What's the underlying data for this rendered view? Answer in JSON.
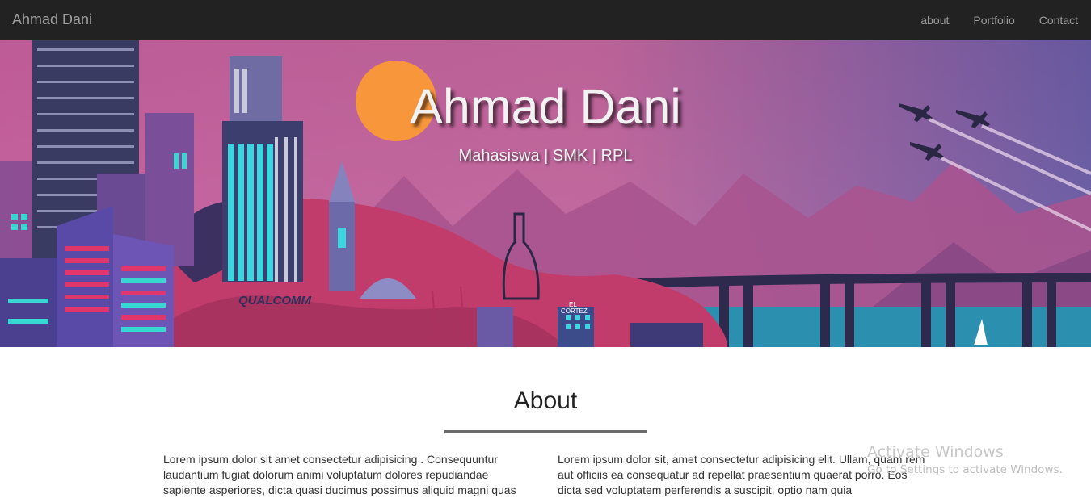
{
  "navbar": {
    "brand": "Ahmad Dani",
    "links": [
      "about",
      "Portfolio",
      "Contact"
    ]
  },
  "hero": {
    "title": "Ahmad Dani",
    "subtitle": "Mahasiswa | SMK | RPL",
    "image_signs": [
      "QUALCOMM",
      "EL",
      "CORTEZ"
    ]
  },
  "about": {
    "title": "About",
    "left_text": "Lorem ipsum dolor sit amet consectetur adipisicing . Consequuntur laudantium fugiat dolorum animi voluptatum dolores repudiandae sapiente asperiores, dicta quasi ducimus possimus aliquid magni quas",
    "right_text": "Lorem ipsum dolor sit, amet consectetur adipisicing elit. Ullam, quam rem aut officiis ea consequatur ad repellat praesentium quaerat porro. Eos dicta sed voluptatem perferendis a suscipit, optio nam quia"
  },
  "watermark": {
    "title": "Activate Windows",
    "subtitle": "Go to Settings to activate Windows."
  },
  "colors": {
    "navbar_bg": "#222222",
    "nav_text": "#9d9d9d",
    "sky_top": "#c85f9e",
    "sky_right": "#6a5ea8",
    "sun": "#f7963a",
    "water": "#2b8fb0"
  }
}
